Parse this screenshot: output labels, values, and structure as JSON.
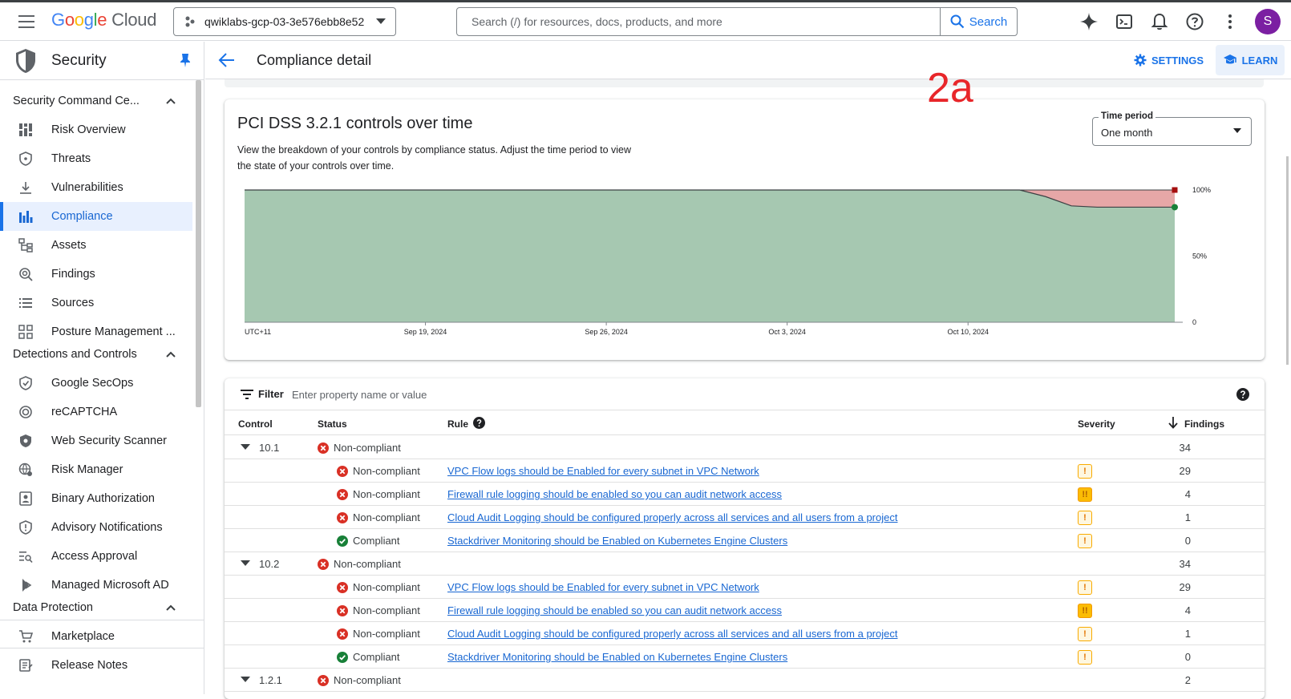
{
  "topbar": {
    "project_name": "qwiklabs-gcp-03-3e576ebb8e52",
    "search_placeholder": "Search (/) for resources, docs, products, and more",
    "search_button": "Search",
    "avatar_initial": "S"
  },
  "logo": {
    "letters": [
      "G",
      "o",
      "o",
      "g",
      "l",
      "e"
    ],
    "product": "Cloud"
  },
  "sidebar": {
    "title": "Security",
    "sections": [
      {
        "label": "Security Command Ce...",
        "items": [
          {
            "label": "Risk Overview",
            "icon": "dashboard-icon"
          },
          {
            "label": "Threats",
            "icon": "shield-icon"
          },
          {
            "label": "Vulnerabilities",
            "icon": "download-icon"
          },
          {
            "label": "Compliance",
            "icon": "bar-chart-icon",
            "active": true
          },
          {
            "label": "Assets",
            "icon": "hierarchy-icon"
          },
          {
            "label": "Findings",
            "icon": "radar-search-icon"
          },
          {
            "label": "Sources",
            "icon": "list-icon"
          },
          {
            "label": "Posture Management ...",
            "icon": "grid-icon"
          }
        ]
      },
      {
        "label": "Detections and Controls",
        "items": [
          {
            "label": "Google SecOps",
            "icon": "shield-check-icon"
          },
          {
            "label": "reCAPTCHA",
            "icon": "recaptcha-icon"
          },
          {
            "label": "Web Security Scanner",
            "icon": "shield-scan-icon"
          },
          {
            "label": "Risk Manager",
            "icon": "globe-gear-icon"
          },
          {
            "label": "Binary Authorization",
            "icon": "badge-icon"
          },
          {
            "label": "Advisory Notifications",
            "icon": "shield-alert-icon"
          },
          {
            "label": "Access Approval",
            "icon": "search-list-icon"
          },
          {
            "label": "Managed Microsoft AD",
            "icon": "diamond-icon"
          }
        ]
      },
      {
        "label": "Data Protection",
        "items": []
      }
    ],
    "footer_items": [
      {
        "label": "Marketplace",
        "icon": "cart-icon"
      },
      {
        "label": "Release Notes",
        "icon": "notes-icon"
      }
    ]
  },
  "header": {
    "page_title": "Compliance detail",
    "settings": "SETTINGS",
    "learn": "LEARN",
    "annotation": "2a"
  },
  "chart_card": {
    "title": "PCI DSS 3.2.1 controls over time",
    "description": "View the breakdown of your controls by compliance status. Adjust the time period to view the state of your controls over time.",
    "time_period_label": "Time period",
    "time_period_value": "One month"
  },
  "chart_data": {
    "type": "area",
    "timezone_label": "UTC+11",
    "x_ticks": [
      "Sep 19, 2024",
      "Sep 26, 2024",
      "Oct 3, 2024",
      "Oct 10, 2024"
    ],
    "y_ticks": [
      "100%",
      "50%",
      "0"
    ],
    "ylim": [
      0,
      100
    ],
    "colors": {
      "compliant": "#a6c8b1",
      "noncompliant": "#e6a7a7",
      "compliant_marker": "#188038",
      "noncompliant_marker": "#a50e0e"
    },
    "compliant_pct": [
      100,
      100,
      100,
      100,
      100,
      100,
      100,
      100,
      100,
      100,
      100,
      100,
      100,
      100,
      100,
      100,
      100,
      100,
      100,
      100,
      100,
      100,
      100,
      100,
      100,
      100,
      100,
      100,
      100,
      100,
      100,
      95,
      88,
      87,
      87,
      87,
      87
    ],
    "total_pct": 100
  },
  "table": {
    "filter_label": "Filter",
    "filter_placeholder": "Enter property name or value",
    "columns": {
      "control": "Control",
      "status": "Status",
      "rule": "Rule",
      "severity": "Severity",
      "findings": "Findings"
    },
    "groups": [
      {
        "control": "10.1",
        "status": "Non-compliant",
        "findings": "34",
        "rows": [
          {
            "status": "Non-compliant",
            "rule": "VPC Flow logs should be Enabled for every subnet in VPC Network",
            "severity": "medium",
            "findings": "29"
          },
          {
            "status": "Non-compliant",
            "rule": "Firewall rule logging should be enabled so you can audit network access",
            "severity": "high",
            "findings": "4"
          },
          {
            "status": "Non-compliant",
            "rule": "Cloud Audit Logging should be configured properly across all services and all users from a project",
            "severity": "medium",
            "findings": "1"
          },
          {
            "status": "Compliant",
            "rule": "Stackdriver Monitoring should be Enabled on Kubernetes Engine Clusters",
            "severity": "medium",
            "findings": "0"
          }
        ]
      },
      {
        "control": "10.2",
        "status": "Non-compliant",
        "findings": "34",
        "rows": [
          {
            "status": "Non-compliant",
            "rule": "VPC Flow logs should be Enabled for every subnet in VPC Network",
            "severity": "medium",
            "findings": "29"
          },
          {
            "status": "Non-compliant",
            "rule": "Firewall rule logging should be enabled so you can audit network access",
            "severity": "high",
            "findings": "4"
          },
          {
            "status": "Non-compliant",
            "rule": "Cloud Audit Logging should be configured properly across all services and all users from a project",
            "severity": "medium",
            "findings": "1"
          },
          {
            "status": "Compliant",
            "rule": "Stackdriver Monitoring should be Enabled on Kubernetes Engine Clusters",
            "severity": "medium",
            "findings": "0"
          }
        ]
      },
      {
        "control": "1.2.1",
        "status": "Non-compliant",
        "findings": "2",
        "rows": []
      }
    ],
    "severity_glyphs": {
      "medium": "!",
      "high": "!!"
    }
  }
}
